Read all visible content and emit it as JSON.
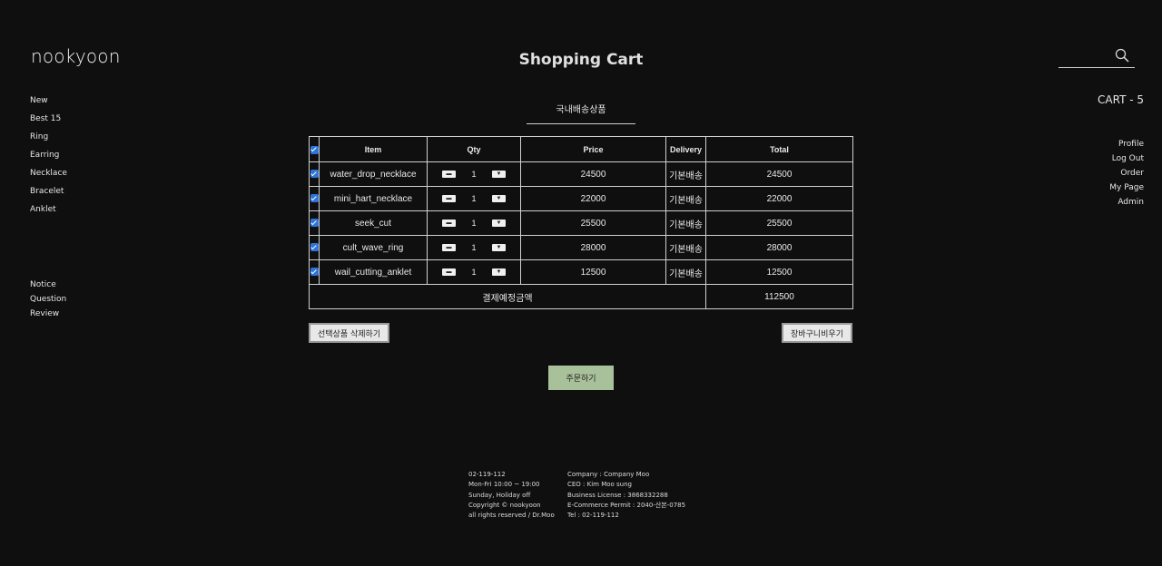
{
  "brand": {
    "logo": "nookyoon"
  },
  "page": {
    "title": "Shopping Cart"
  },
  "left_nav": {
    "primary": [
      "New",
      "Best 15",
      "Ring",
      "Earring",
      "Necklace",
      "Bracelet",
      "Anklet"
    ],
    "secondary": [
      "Notice",
      "Question",
      "Review"
    ]
  },
  "search": {
    "value": "",
    "placeholder": ""
  },
  "cart_indicator": "CART - 5",
  "right_nav": [
    "Profile",
    "Log Out",
    "Order",
    "My Page",
    "Admin"
  ],
  "tab": {
    "label": "국내배송상품"
  },
  "table": {
    "headers": {
      "item": "Item",
      "qty": "Qty",
      "price": "Price",
      "delivery": "Delivery",
      "total": "Total"
    },
    "rows": [
      {
        "item": "water_drop_necklace",
        "qty": "1",
        "price": "24500",
        "delivery": "기본배송",
        "total": "24500"
      },
      {
        "item": "mini_hart_necklace",
        "qty": "1",
        "price": "22000",
        "delivery": "기본배송",
        "total": "22000"
      },
      {
        "item": "seek_cut",
        "qty": "1",
        "price": "25500",
        "delivery": "기본배송",
        "total": "25500"
      },
      {
        "item": "cult_wave_ring",
        "qty": "1",
        "price": "28000",
        "delivery": "기본배송",
        "total": "28000"
      },
      {
        "item": "wail_cutting_anklet",
        "qty": "1",
        "price": "12500",
        "delivery": "기본배송",
        "total": "12500"
      }
    ],
    "summary_label": "결제예정금액",
    "summary_total": "112500"
  },
  "buttons": {
    "delete_selected": "선택상품 삭제하기",
    "empty_cart": "장바구니비우기",
    "order": "주문하기"
  },
  "footer": {
    "col1": [
      "02-119-112",
      "Mon-Fri 10:00 ~ 19:00",
      "Sunday, Holiday off",
      "Copyright © nookyoon",
      "all rights reserved / Dr.Moo"
    ],
    "col2": [
      "Company : Company Moo",
      "CEO : Kim Moo sung",
      "Business License : 3868332288",
      "E-Commerce Permit : 2040-산본-0785",
      "Tel : 02-119-112"
    ]
  },
  "colors": {
    "background": "#0f0f0f",
    "order_button": "#a9c19b",
    "checkbox": "#2f74d8"
  },
  "icons": {
    "search": "search-icon",
    "qty_decrease": "minus-icon",
    "qty_increase": "chevron-down-icon"
  }
}
